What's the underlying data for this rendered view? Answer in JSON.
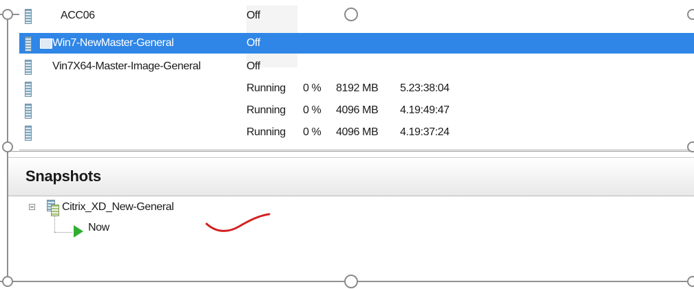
{
  "vm_list": {
    "rows": [
      {
        "name": "ACC06",
        "state": "Off",
        "cpu": "",
        "memory": "",
        "uptime": "",
        "selected": false
      },
      {
        "name": "Win7-NewMaster-General",
        "state": "Off",
        "cpu": "",
        "memory": "",
        "uptime": "",
        "selected": true
      },
      {
        "name": "Vin7X64-Master-Image-General",
        "state": "Off",
        "cpu": "",
        "memory": "",
        "uptime": "",
        "selected": false
      },
      {
        "name": "",
        "state": "Running",
        "cpu": "0 %",
        "memory": "8192 MB",
        "uptime": "5.23:38:04",
        "selected": false
      },
      {
        "name": "",
        "state": "Running",
        "cpu": "0 %",
        "memory": "4096 MB",
        "uptime": "4.19:49:47",
        "selected": false
      },
      {
        "name": "",
        "state": "Running",
        "cpu": "0 %",
        "memory": "4096 MB",
        "uptime": "4.19:37:24",
        "selected": false
      }
    ]
  },
  "snapshots": {
    "title": "Snapshots",
    "tree": {
      "root_label": "Citrix_XD_New-General",
      "child_label": "Now"
    }
  },
  "icons": {
    "vm": "virtual-machine-icon",
    "snapshot": "snapshot-icon",
    "now": "play-triangle-icon",
    "expander": "collapse-minus-icon"
  },
  "colors": {
    "selection": "#2f86e6",
    "now_play": "#2fae2f",
    "annotation": "#d42020"
  }
}
